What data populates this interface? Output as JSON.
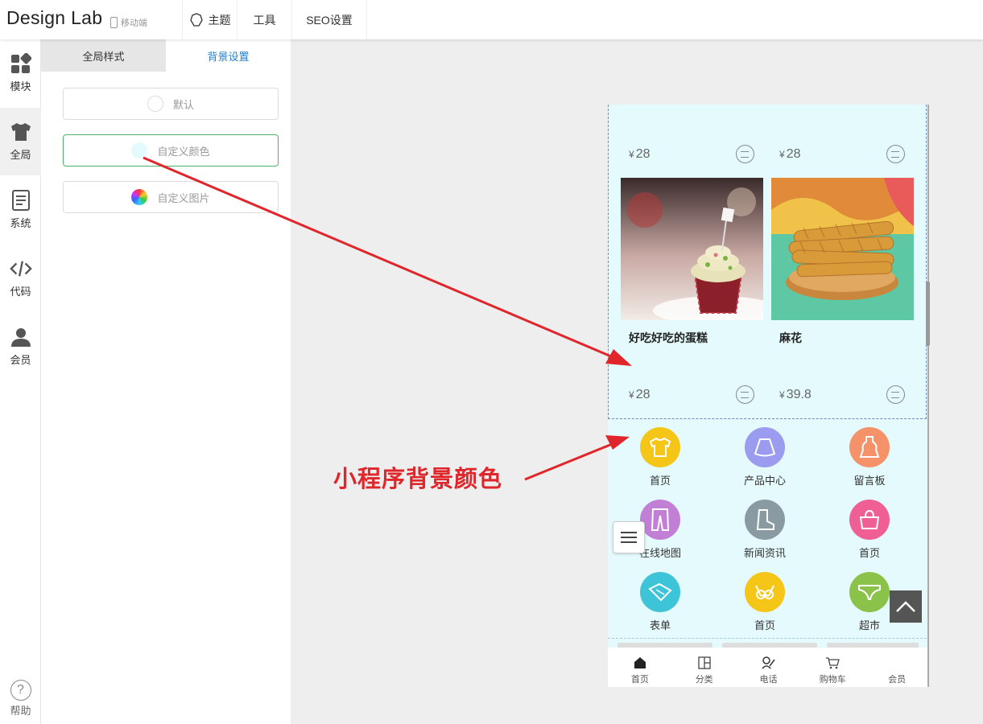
{
  "header": {
    "logo": "Design Lab",
    "mobile_label": "移动端",
    "nav": [
      {
        "label": "主题",
        "icon": "theme-icon"
      },
      {
        "label": "工具",
        "icon": ""
      },
      {
        "label": "SEO设置",
        "icon": ""
      }
    ]
  },
  "sidebar": {
    "items": [
      {
        "label": "模块",
        "icon": "modules-icon"
      },
      {
        "label": "全局",
        "icon": "shirt-icon"
      },
      {
        "label": "系统",
        "icon": "document-icon"
      },
      {
        "label": "代码",
        "icon": "code-icon"
      },
      {
        "label": "会员",
        "icon": "user-icon"
      }
    ],
    "help_label": "帮助"
  },
  "panel": {
    "tabs": [
      "全局样式",
      "背景设置"
    ],
    "active_tab": "背景设置",
    "options": [
      {
        "label": "默认",
        "swatch": "#ffffff"
      },
      {
        "label": "自定义颜色",
        "swatch": "#e4fafc"
      },
      {
        "label": "自定义图片",
        "swatch": "rainbow"
      }
    ],
    "selected_option": "自定义颜色"
  },
  "preview": {
    "background_color": "#e4fafc",
    "top_prices": [
      {
        "currency": "¥",
        "value": "28"
      },
      {
        "currency": "¥",
        "value": "28"
      }
    ],
    "products": [
      {
        "name": "好吃好吃的蛋糕",
        "currency": "¥",
        "price": "28",
        "image": "cupcake"
      },
      {
        "name": "麻花",
        "currency": "¥",
        "price": "39.8",
        "image": "fried-dough-twist"
      }
    ],
    "grid": [
      {
        "label": "首页",
        "color": "#f5c518",
        "icon": "shirt-icon"
      },
      {
        "label": "产品中心",
        "color": "#9b9bf0",
        "icon": "skirt-icon"
      },
      {
        "label": "留言板",
        "color": "#f5926a",
        "icon": "dress-icon"
      },
      {
        "label": "在线地图",
        "color": "#c17fd6",
        "icon": "pants-icon"
      },
      {
        "label": "新闻资讯",
        "color": "#8a9aa3",
        "icon": "boot-icon"
      },
      {
        "label": "首页",
        "color": "#ef5f93",
        "icon": "bag-icon"
      },
      {
        "label": "表单",
        "color": "#3ec4d9",
        "icon": "tag-icon"
      },
      {
        "label": "首页",
        "color": "#f5c518",
        "icon": "bra-icon"
      },
      {
        "label": "超市",
        "color": "#8bc34a",
        "icon": "underwear-icon"
      }
    ],
    "tabbar": [
      {
        "label": "首页",
        "icon": "home-icon"
      },
      {
        "label": "分类",
        "icon": "category-icon"
      },
      {
        "label": "电话",
        "icon": "phone-icon"
      },
      {
        "label": "购物车",
        "icon": "cart-icon"
      },
      {
        "label": "会员",
        "icon": "member-icon"
      }
    ]
  },
  "annotation": {
    "text": "小程序背景颜色",
    "color": "#e0262b"
  }
}
